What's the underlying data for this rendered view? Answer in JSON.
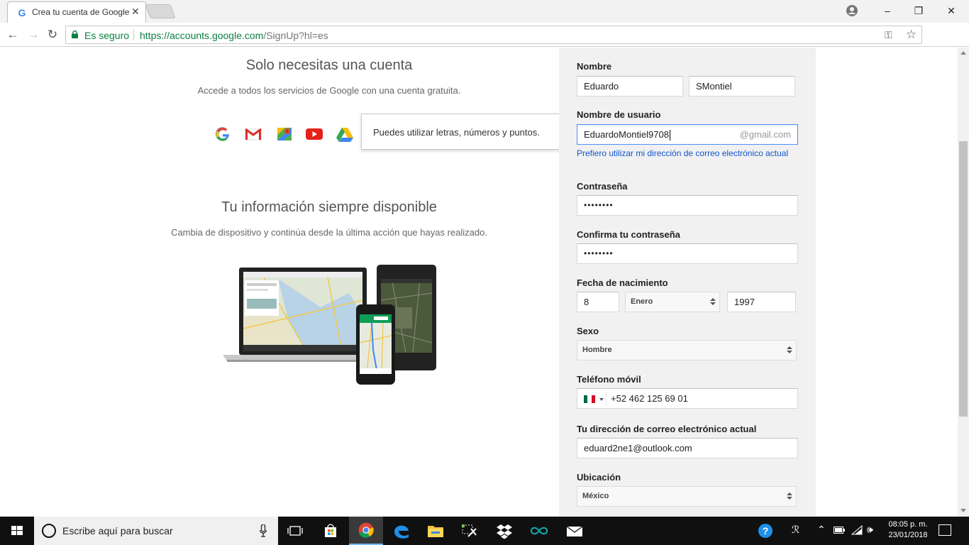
{
  "browser": {
    "tab_title": "Crea tu cuenta de Google",
    "tab_favicon": "G",
    "security_label": "Es seguro",
    "url_host": "https://accounts.google.com",
    "url_path": "/SignUp?hl=es",
    "window_controls": [
      "–",
      "❐",
      "✕"
    ]
  },
  "left": {
    "heading1": "Solo necesitas una cuenta",
    "sub1": "Accede a todos los servicios de Google con una cuenta gratuita.",
    "product_icons": [
      "google-icon",
      "gmail-icon",
      "maps-icon",
      "youtube-icon",
      "drive-icon"
    ],
    "heading2": "Tu información siempre disponible",
    "sub2": "Cambia de dispositivo y continúa desde la última acción que hayas realizado."
  },
  "tooltip": {
    "text": "Puedes utilizar letras, números y puntos."
  },
  "form": {
    "name_label": "Nombre",
    "first_name": "Eduardo",
    "last_name": "SMontiel",
    "username_label": "Nombre de usuario",
    "username": "EduardoMontiel9708",
    "gmail_suffix": "@gmail.com",
    "alt_email_link": "Prefiero utilizar mi dirección de correo electrónico actual",
    "password_label": "Contraseña",
    "password": "••••••••",
    "confirm_label": "Confirma tu contraseña",
    "confirm": "••••••••",
    "birth_label": "Fecha de nacimiento",
    "birth_day": "8",
    "birth_month": "Enero",
    "birth_year": "1997",
    "gender_label": "Sexo",
    "gender": "Hombre",
    "phone_label": "Teléfono móvil",
    "phone": "+52 462 125 69 01",
    "current_email_label": "Tu dirección de correo electrónico actual",
    "current_email": "eduard2ne1@outlook.com",
    "location_label": "Ubicación",
    "location": "México"
  },
  "taskbar": {
    "search_placeholder": "Escribe aquí para buscar",
    "time": "08:05 p. m.",
    "date": "23/01/2018",
    "pinned": [
      "task-view-icon",
      "store-icon",
      "chrome-icon",
      "edge-icon",
      "file-explorer-icon",
      "tools-icon",
      "dropbox-icon",
      "arduino-icon",
      "mail-icon"
    ]
  },
  "colors": {
    "secure_green": "#0b8043",
    "link_blue": "#1155cc",
    "focus_blue": "#4d90fe",
    "form_bg": "#f1f1f1"
  }
}
